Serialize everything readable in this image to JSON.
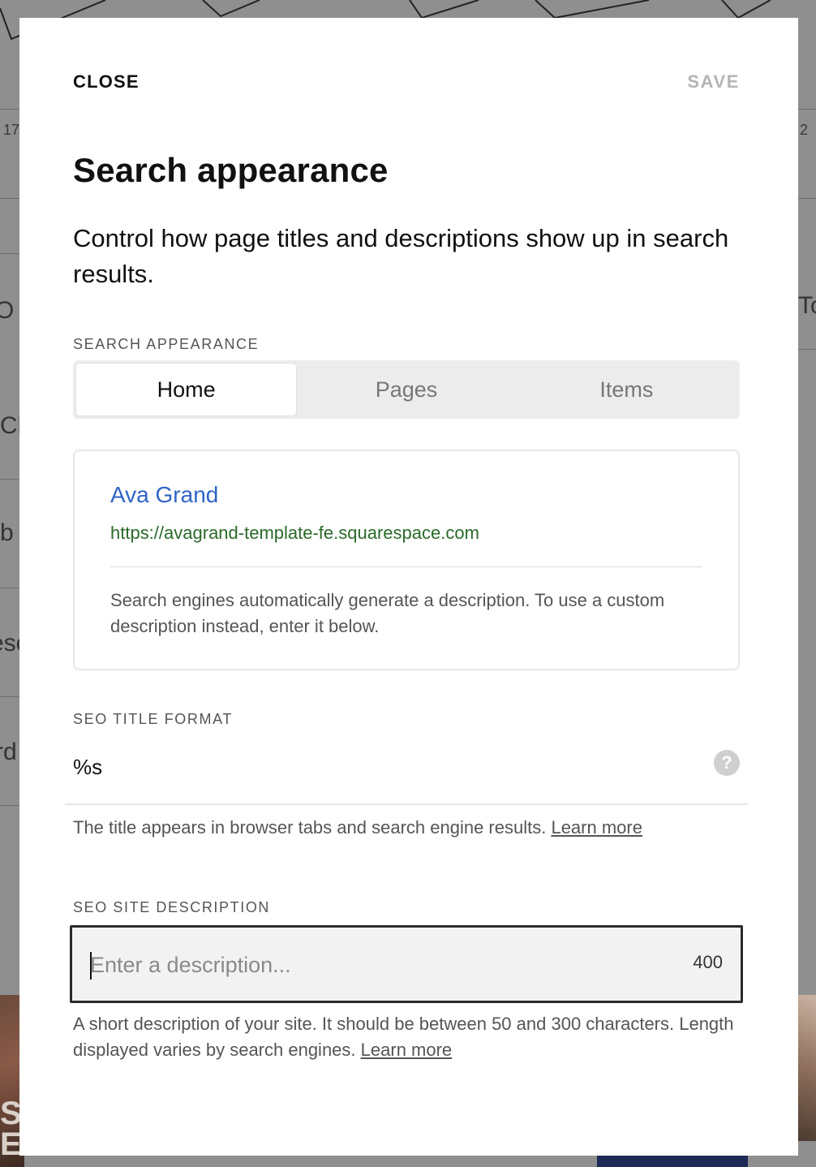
{
  "background": {
    "fragments": [
      "17",
      "2",
      "O",
      "To",
      "Cl",
      "b",
      "esc",
      "rd",
      "ST",
      "EA"
    ]
  },
  "modal": {
    "close_label": "CLOSE",
    "save_label": "SAVE",
    "title": "Search appearance",
    "subtitle": "Control how page titles and descriptions show up in search results.",
    "section_label": "SEARCH APPEARANCE",
    "tabs": [
      {
        "label": "Home",
        "active": true
      },
      {
        "label": "Pages",
        "active": false
      },
      {
        "label": "Items",
        "active": false
      }
    ],
    "preview": {
      "title": "Ava Grand",
      "url": "https://avagrand-template-fe.squarespace.com",
      "description": "Search engines automatically generate a description. To use a custom description instead, enter it below."
    },
    "seo_title": {
      "label": "SEO TITLE FORMAT",
      "value": "%s",
      "help_icon": "question-icon",
      "helper_text": "The title appears in browser tabs and search engine results.",
      "learn_more": "Learn more"
    },
    "seo_description": {
      "label": "SEO SITE DESCRIPTION",
      "placeholder": "Enter a description...",
      "char_count": "400",
      "helper_text": "A short description of your site. It should be between 50 and 300 characters. Length displayed varies by search engines.",
      "learn_more": "Learn more"
    }
  },
  "colors": {
    "link_blue": "#2f64c6",
    "url_green": "#2a6a2a",
    "save_disabled": "#b4b4b4",
    "overlay": "#8f8f8f"
  }
}
